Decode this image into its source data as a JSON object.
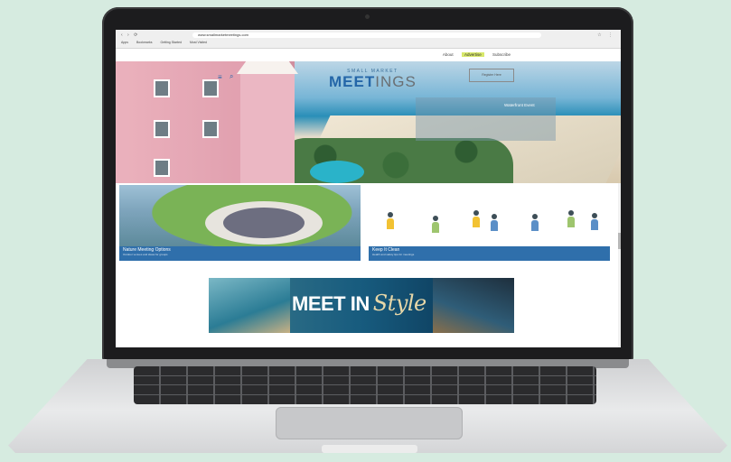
{
  "browser": {
    "url": "www.smallmarketmeetings.com",
    "bookmarks": [
      "Apps",
      "Bookmarks",
      "Getting Started",
      "Most Visited"
    ]
  },
  "header": {
    "util_links": [
      "About",
      "Advertise",
      "Subscribe"
    ],
    "logo_small": "SMALL MARKET",
    "logo_meet": "MEET",
    "logo_ings": "INGS",
    "register_label": "Register Here",
    "hero_caption": "Waterfront Event"
  },
  "cards": [
    {
      "title": "Nature Meeting Options",
      "subtitle": "Outdoor venues and ideas for groups"
    },
    {
      "title": "Keep It Clean",
      "subtitle": "Health and safety tips for meetings"
    }
  ],
  "banner": {
    "text": "MEET IN",
    "script": "Style"
  },
  "colors": {
    "brand_blue": "#2466a8",
    "card_bar": "#2f6fab",
    "background": "#d6ebe0"
  },
  "icons": [
    "menu-icon",
    "search-icon"
  ]
}
